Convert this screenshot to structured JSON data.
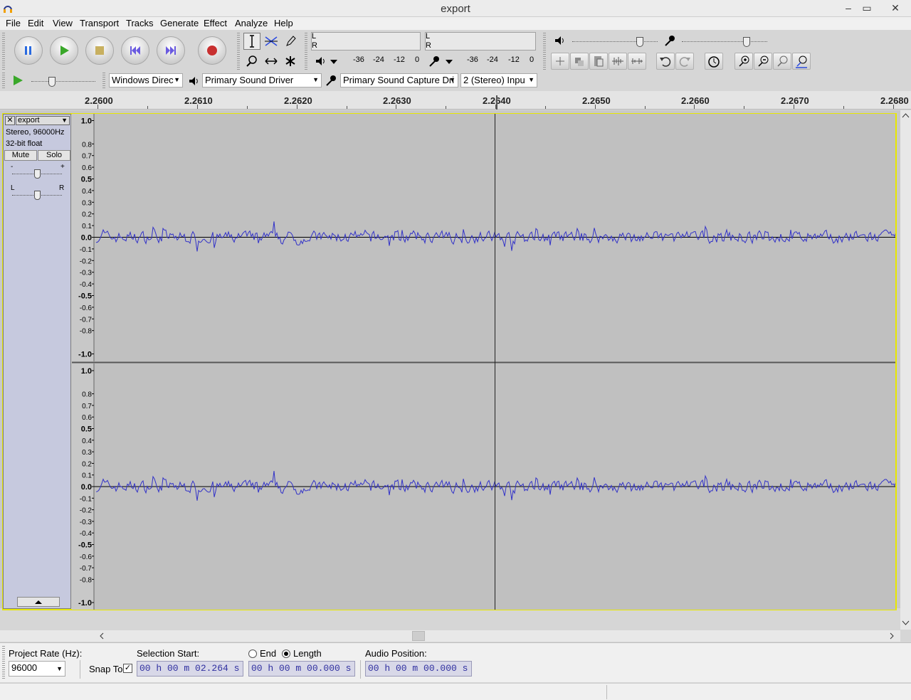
{
  "window": {
    "title": "export",
    "min": "–",
    "restore": "▭",
    "close": "✕"
  },
  "menu": [
    "File",
    "Edit",
    "View",
    "Transport",
    "Tracks",
    "Generate",
    "Effect",
    "Analyze",
    "Help"
  ],
  "meters": {
    "play_ticks": [
      "-36",
      "-24",
      "-12",
      "0"
    ],
    "rec_ticks": [
      "-36",
      "-24",
      "-12",
      "0"
    ],
    "l": "L",
    "r": "R"
  },
  "device": {
    "host": "Windows Direc",
    "output": "Primary Sound Driver",
    "input": "Primary Sound Capture Dri",
    "channels": "2 (Stereo) Inpu"
  },
  "ruler": {
    "labels": [
      "2.2600",
      "2.2610",
      "2.2620",
      "2.2630",
      "2.2640",
      "2.2650",
      "2.2660",
      "2.2670",
      "2.2680"
    ]
  },
  "track": {
    "name": "export",
    "info1": "Stereo, 96000Hz",
    "info2": "32-bit float",
    "mute": "Mute",
    "solo": "Solo",
    "gain_minus": "-",
    "gain_plus": "+",
    "pan_l": "L",
    "pan_r": "R"
  },
  "yaxis": [
    "1.0",
    "0.8",
    "0.7",
    "0.6",
    "0.5",
    "0.4",
    "0.3",
    "0.2",
    "0.1",
    "0.0",
    "-0.1",
    "-0.2",
    "-0.3",
    "-0.4",
    "-0.5",
    "-0.6",
    "-0.7",
    "-0.8",
    "-1.0"
  ],
  "bottom": {
    "rate_label": "Project Rate (Hz):",
    "rate": "96000",
    "snap": "Snap To",
    "sel_start_label": "Selection Start:",
    "end_label": "End",
    "length_label": "Length",
    "audio_pos_label": "Audio Position:",
    "sel_start": "00 h 00 m 02.264 s",
    "length": "00 h 00 m 00.000 s",
    "audio_pos": "00 h 00 m 00.000 s"
  },
  "colors": {
    "wave": "#3232c8",
    "bg": "#c0c0c0",
    "accent": "#e8e800"
  }
}
